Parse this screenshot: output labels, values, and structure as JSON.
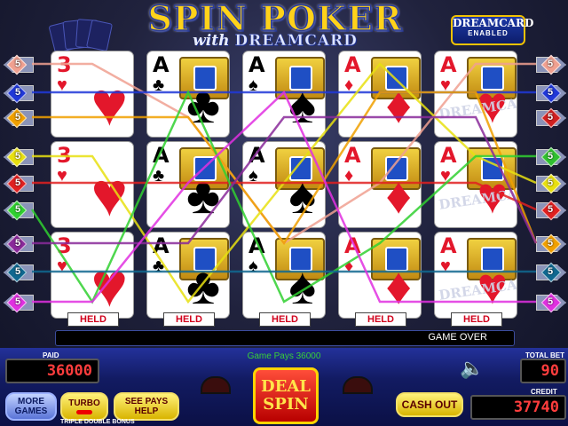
{
  "title": {
    "main": "SPIN POKER",
    "sub_with": "with",
    "sub_brand": "DREAMCARD"
  },
  "badge": {
    "line1": "DREAMCARD",
    "line2": "ENABLED"
  },
  "paylines_left": [
    {
      "number": "5",
      "color": "#f0a090"
    },
    {
      "number": "5",
      "color": "#2038d8"
    },
    {
      "number": "5",
      "color": "#f0a000"
    },
    {
      "number": "5",
      "color": "#e8e010"
    },
    {
      "number": "5",
      "color": "#e02020"
    },
    {
      "number": "5",
      "color": "#30d030"
    },
    {
      "number": "5",
      "color": "#8a2a9a"
    },
    {
      "number": "5",
      "color": "#106890"
    },
    {
      "number": "5",
      "color": "#e030e0"
    }
  ],
  "paylines_right": [
    {
      "number": "5",
      "color": "#f0a090"
    },
    {
      "number": "5",
      "color": "#2038d8"
    },
    {
      "number": "5",
      "color": "#d02020"
    },
    {
      "number": "5",
      "color": "#30c030"
    },
    {
      "number": "5",
      "color": "#e8e010"
    },
    {
      "number": "5",
      "color": "#e02020"
    },
    {
      "number": "5",
      "color": "#f0a000"
    },
    {
      "number": "5",
      "color": "#106890"
    },
    {
      "number": "5",
      "color": "#e030e0"
    }
  ],
  "cards": [
    {
      "rank": "3",
      "suit": "♥",
      "color": "red",
      "held": "HELD"
    },
    {
      "rank": "A",
      "suit": "♣",
      "color": "blk",
      "held": "HELD"
    },
    {
      "rank": "A",
      "suit": "♠",
      "color": "blk",
      "held": "HELD"
    },
    {
      "rank": "A",
      "suit": "♦",
      "color": "red",
      "held": "HELD"
    },
    {
      "rank": "A",
      "suit": "♥",
      "color": "red",
      "held": "HELD"
    }
  ],
  "watermark": "DREAMCARD",
  "status": "GAME OVER",
  "game_pays": "Game Pays 36000",
  "paid": {
    "label": "PAID",
    "value": "36000"
  },
  "total_bet": {
    "label": "TOTAL BET",
    "value": "90"
  },
  "credit": {
    "label": "CREDIT",
    "value": "37740"
  },
  "buttons": {
    "more_games": "MORE GAMES",
    "turbo": "TURBO",
    "see_pays": "SEE PAYS HELP",
    "deal_spin_1": "DEAL",
    "deal_spin_2": "SPIN",
    "cash_out": "CASH OUT"
  },
  "game_name": "TRIPLE DOUBLE BONUS",
  "icons": {
    "speaker": "speaker-icon",
    "gem": "diamond-gem-icon"
  }
}
